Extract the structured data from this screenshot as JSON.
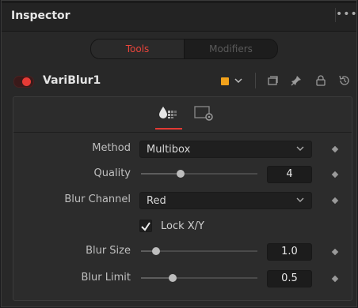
{
  "window": {
    "title": "Inspector",
    "more": "•••"
  },
  "tabs": [
    {
      "label": "Tools",
      "active": true
    },
    {
      "label": "Modifiers",
      "active": false
    }
  ],
  "node": {
    "name": "VariBlur1",
    "color": "#f2a21b",
    "enabled": true
  },
  "header_icons": [
    "color-swatch-icon",
    "chevron-down-icon",
    "versions-icon",
    "pin-icon",
    "lock-icon",
    "reset-icon"
  ],
  "subtabs": [
    {
      "icon": "droplet-blur-icon",
      "active": true
    },
    {
      "icon": "settings-gear-icon",
      "active": false
    }
  ],
  "controls": {
    "method": {
      "label": "Method",
      "value": "Multibox"
    },
    "quality": {
      "label": "Quality",
      "value": "4",
      "fraction": 0.34
    },
    "blur_channel": {
      "label": "Blur Channel",
      "value": "Red"
    },
    "lock_xy": {
      "label": "Lock X/Y",
      "checked": true
    },
    "blur_size": {
      "label": "Blur Size",
      "value": "1.0",
      "fraction": 0.13
    },
    "blur_limit": {
      "label": "Blur Limit",
      "value": "0.5",
      "fraction": 0.27
    }
  },
  "accent_color": "#e33a33"
}
